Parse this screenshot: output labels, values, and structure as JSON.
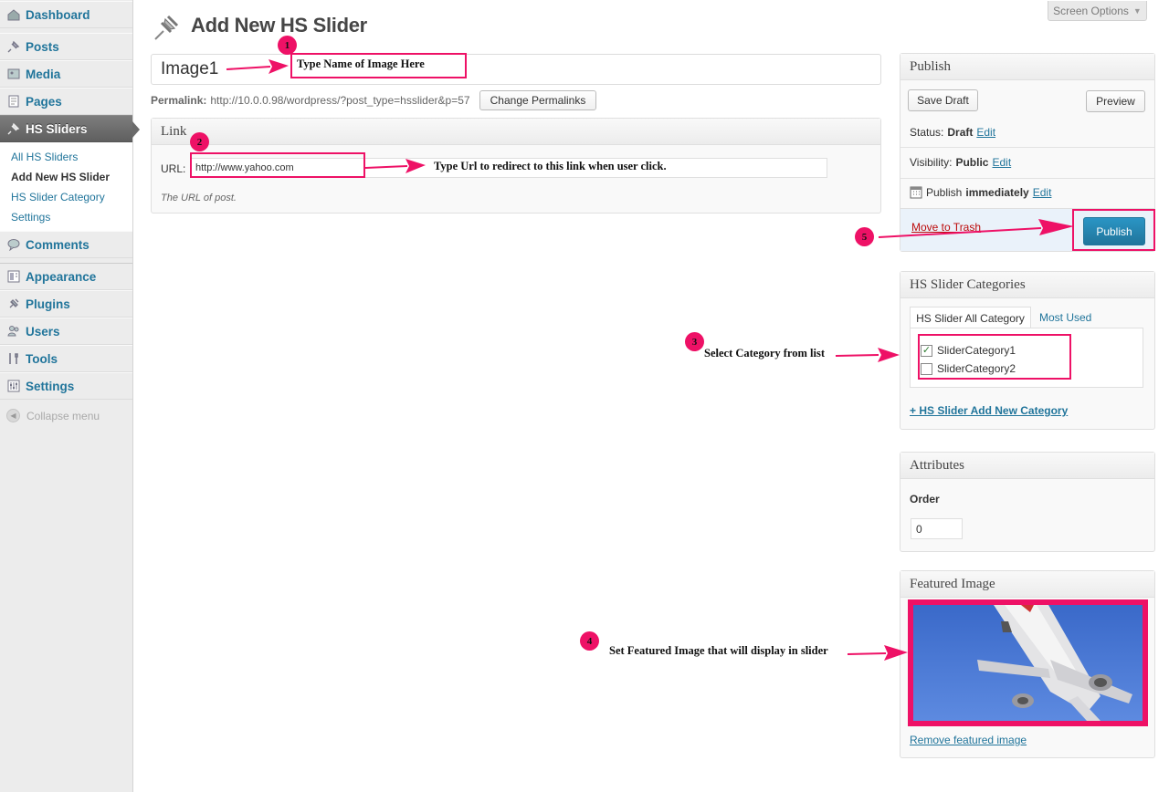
{
  "sidebar": {
    "items": [
      {
        "label": "Dashboard",
        "icon": "dashboard-icon"
      },
      {
        "label": "Posts",
        "icon": "pin-icon"
      },
      {
        "label": "Media",
        "icon": "media-icon"
      },
      {
        "label": "Pages",
        "icon": "pages-icon"
      },
      {
        "label": "HS Sliders",
        "icon": "pin-icon"
      },
      {
        "label": "Comments",
        "icon": "comments-icon"
      },
      {
        "label": "Appearance",
        "icon": "appearance-icon"
      },
      {
        "label": "Plugins",
        "icon": "plugins-icon"
      },
      {
        "label": "Users",
        "icon": "users-icon"
      },
      {
        "label": "Tools",
        "icon": "tools-icon"
      },
      {
        "label": "Settings",
        "icon": "settings-icon"
      }
    ],
    "submenu": [
      "All HS Sliders",
      "Add New HS Slider",
      "HS Slider Category",
      "Settings"
    ],
    "collapse_label": "Collapse menu"
  },
  "header": {
    "title": "Add New HS Slider",
    "screen_options": "Screen Options"
  },
  "title_field": {
    "value": "Image1"
  },
  "permalink": {
    "label": "Permalink:",
    "url": "http://10.0.0.98/wordpress/?post_type=hsslider&p=57",
    "button": "Change Permalinks"
  },
  "link_box": {
    "title": "Link",
    "url_label": "URL:",
    "url_value": "http://www.yahoo.com",
    "help": "The URL of post."
  },
  "publish": {
    "title": "Publish",
    "save_draft": "Save Draft",
    "preview": "Preview",
    "status_label": "Status:",
    "status_value": "Draft",
    "visibility_label": "Visibility:",
    "visibility_value": "Public",
    "publish_label": "Publish",
    "publish_value": "immediately",
    "edit": "Edit",
    "trash": "Move to Trash",
    "publish_button": "Publish"
  },
  "categories": {
    "title": "HS Slider Categories",
    "tab_all": "HS Slider All Category",
    "tab_used": "Most Used",
    "items": [
      {
        "label": "SliderCategory1",
        "checked": true
      },
      {
        "label": "SliderCategory2",
        "checked": false
      }
    ],
    "add_new": "+ HS Slider Add New Category"
  },
  "attributes": {
    "title": "Attributes",
    "order_label": "Order",
    "order_value": "0"
  },
  "featured": {
    "title": "Featured Image",
    "remove": "Remove featured image"
  },
  "annotations": [
    {
      "num": "1",
      "text": "Type Name of Image Here"
    },
    {
      "num": "2",
      "text": "Type Url to redirect to this link when user click."
    },
    {
      "num": "3",
      "text": "Select Category from list"
    },
    {
      "num": "4",
      "text": "Set Featured Image that will display in slider"
    },
    {
      "num": "5",
      "text": ""
    }
  ],
  "colors": {
    "annotation": "#ee1166",
    "link": "#21759b",
    "publish_button": "#21759b"
  }
}
